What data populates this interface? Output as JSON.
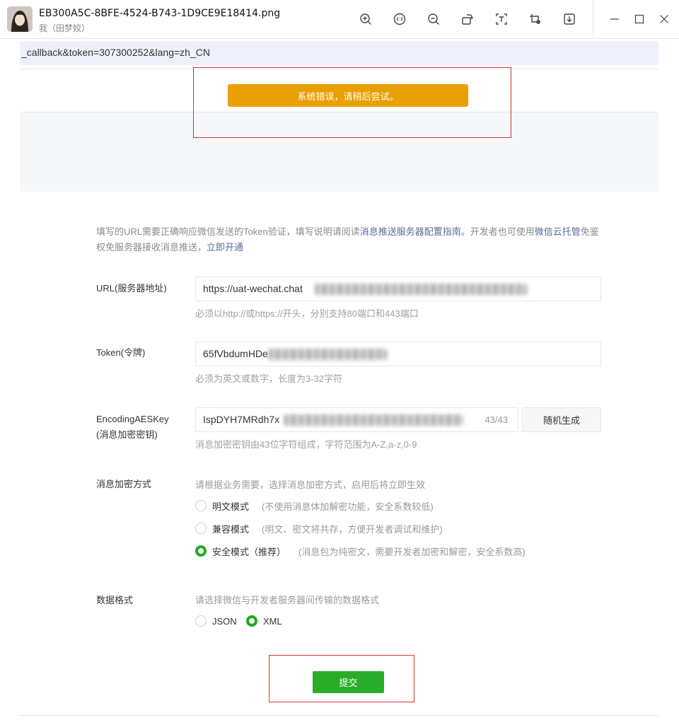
{
  "viewer": {
    "file_name": "EB300A5C-8BFE-4524-B743-1D9CE9E18414.png",
    "sender": "我（田梦姣）",
    "tools": [
      "zoom-in-icon",
      "original-size-icon",
      "zoom-out-icon",
      "rotate-icon",
      "text-extract-icon",
      "screenshot-icon",
      "download-icon"
    ],
    "window_controls": [
      "minimize-icon",
      "maximize-icon",
      "close-icon"
    ]
  },
  "page": {
    "url_fragment": "_callback&token=307300252&lang=zh_CN",
    "error_alert": "系统错误，请稍后尝试。",
    "intro": {
      "text1": "填写的URL需要正确响应微信发送的Token验证，填写说明请阅读",
      "link1": "消息推送服务器配置指南。",
      "text2": "开发者也可使用",
      "link2": "微信云托管",
      "text3": "免鉴权免服务器接收消息推送，",
      "link3": "立即开通"
    },
    "url_field": {
      "label": "URL(服务器地址)",
      "value": "https://uat-wechat.chat",
      "tip": "必须以http://或https://开头，分别支持80端口和443端口"
    },
    "token_field": {
      "label": "Token(令牌)",
      "value": "65fVbdumHDe",
      "tip": "必须为英文或数字，长度为3-32字符"
    },
    "aes_field": {
      "label_line1": "EncodingAESKey",
      "label_line2": "(消息加密密钥)",
      "value": "IspDYH7MRdh7x",
      "counter": "43/43",
      "random_button": "随机生成",
      "tip": "消息加密密钥由43位字符组成，字符范围为A-Z,a-z,0-9"
    },
    "encryption": {
      "label": "消息加密方式",
      "hint": "请根据业务需要，选择消息加密方式，启用后将立即生效",
      "options": [
        {
          "label": "明文模式",
          "desc": "(不使用消息体加解密功能，安全系数较低)",
          "selected": false
        },
        {
          "label": "兼容模式",
          "desc": "(明文、密文将共存，方便开发者调试和维护)",
          "selected": false
        },
        {
          "label": "安全模式（推荐）",
          "desc": "(消息包为纯密文，需要开发者加密和解密，安全系数高)",
          "selected": true
        }
      ]
    },
    "data_format": {
      "label": "数据格式",
      "hint": "请选择微信与开发者服务器间传输的数据格式",
      "options": [
        {
          "label": "JSON",
          "selected": false
        },
        {
          "label": "XML",
          "selected": true
        }
      ]
    },
    "submit_button": "提交"
  },
  "colors": {
    "alert": "#eaa000",
    "primary_green": "#2aae29",
    "link": "#576b95",
    "annotation_red": "#d63434"
  }
}
